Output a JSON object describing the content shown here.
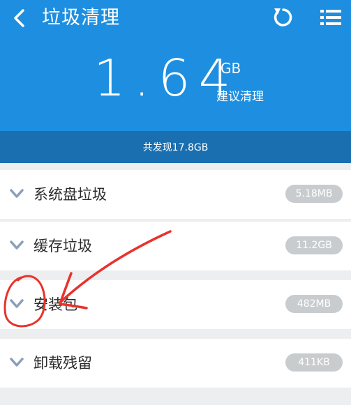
{
  "header": {
    "title": "垃圾清理",
    "back_icon": "chevron-left-icon",
    "refresh_icon": "refresh-icon",
    "menu_icon": "list-menu-icon"
  },
  "summary": {
    "size_value": "1.64",
    "size_unit": "GB",
    "hint": "建议清理",
    "found_text": "共发现17.8GB"
  },
  "list": {
    "items": [
      {
        "label": "系统盘垃圾",
        "size": "5.18MB"
      },
      {
        "label": "缓存垃圾",
        "size": "11.2GB"
      },
      {
        "label": "安装包",
        "size": "482MB"
      },
      {
        "label": "卸载残留",
        "size": "411KB"
      }
    ]
  },
  "colors": {
    "header_blue": "#1e8fe0",
    "found_bar_blue": "#1a6fb0",
    "badge_gray": "#c9cccf",
    "chevron_gray": "#8a9fb8",
    "annotation_red": "#e8322b"
  }
}
